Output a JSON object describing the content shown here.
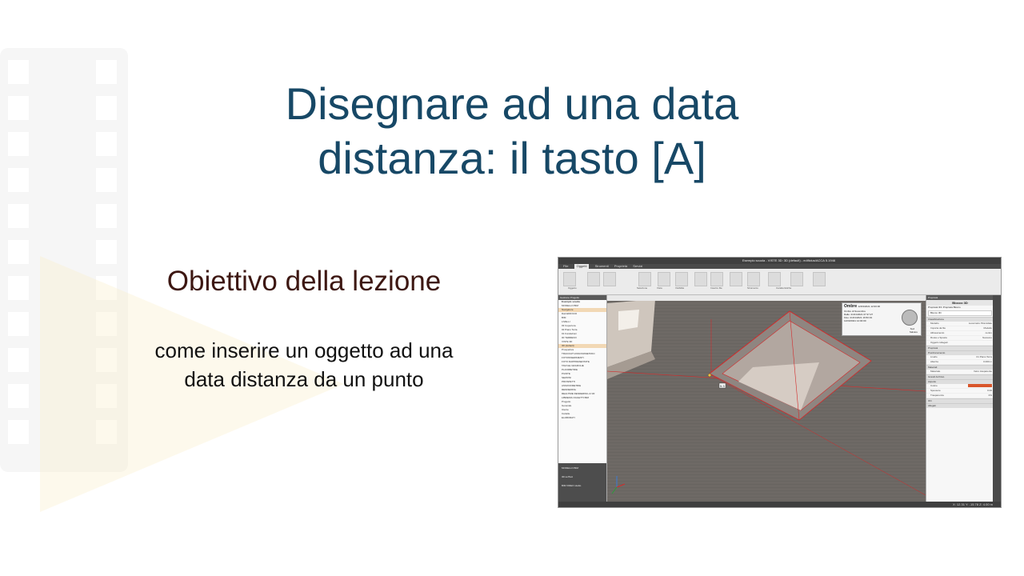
{
  "slide": {
    "title_line1": "Disegnare ad una data",
    "title_line2": "distanza: il tasto [A]",
    "subtitle": "Obiettivo della lezione",
    "body_line1": "come inserire un oggetto ad una",
    "body_line2": "data distanza da un punto"
  },
  "colors": {
    "title": "#174866",
    "subtitle": "#3d1712",
    "body": "#111111",
    "highlight_red": "#d42a2a",
    "selection_orange": "#f2d8b5"
  },
  "screenshot": {
    "window_title": "Esempio scuola - VISTE 3D: 3D (default) - edificius/ACCA 5.1946",
    "menu": [
      "File",
      "Oggetti",
      "Strumenti",
      "Proprietà",
      "Servizi"
    ],
    "active_menu": "Oggetti",
    "ribbon_groups": [
      "Oggetto",
      "Selezione",
      "Vista",
      "Visibilità",
      "Gruppi",
      "Inserire file",
      "Vista",
      "Strumento",
      "Caratteristiche"
    ],
    "left_panel": {
      "header": "Gestione Progetto",
      "project": "Esempio scuola",
      "items": [
        "MODELLO BIM",
        "Navigatore",
        "Dati EDIFICIO",
        "BIM",
        "LIVELLI",
        "03 Copertura",
        "02 Piano Terra",
        "01 Fondazioni",
        "00 TERRENO",
        "VISTE 3D",
        "3D (default)",
        "Prospettiva",
        "TRACCIATI ASSONOMETRICI",
        "FOTOINSERIMENTI",
        "FOTO RAPPRESENTATE",
        "TAVOLE GRAFICHE",
        "PLANIMETRIE",
        "PIANTE",
        "SEZIONI",
        "PROSPETTI",
        "ASSONOMETRIE",
        "RENDERING",
        "REALTIME RENDERING & VR",
        "LIBRERIA OGGETTI BIM",
        "Progetto",
        "Generale",
        "Utente",
        "Cartelle",
        "ELABORATI"
      ],
      "footer_items": [
        "MODELLO BIM",
        "3D solTool",
        "BIM VIDEO studio"
      ]
    },
    "viewport_overlay": {
      "title": "Ombre",
      "date": "12/03/2021 12:00:00",
      "row1": "Ombre di Novembre",
      "row_from": "Dalle: 21/01/2021 07:37:27",
      "row_to": "Fine: 21/01/2021 16:50:19",
      "time": "12/03/2021 12:00:00",
      "compass_label": "Sud",
      "button": "Salvare"
    },
    "viewport_label": "5.3",
    "right_panel": {
      "header": "Proprietà",
      "object_name": "Blocco 3D",
      "tabs": [
        "Proprietà IFC",
        "Proprietà Blocco"
      ],
      "filter": "Blocco 3D",
      "sections": [
        "Classificazione",
        "Proprietà",
        "Posizionamento",
        "Materiali",
        "Grandi Archivio",
        "Aspetto",
        "IFC",
        "Allegati"
      ],
      "rows": [
        {
          "k": "Modello",
          "v": "Lucernario Piramidale"
        },
        {
          "k": "Importa da file",
          "v": "Modello"
        },
        {
          "k": "Allineamento",
          "v": "centro"
        },
        {
          "k": "Ruota e Sposta",
          "v": "Nessuno"
        },
        {
          "k": "Oggetti collegati",
          "v": ""
        },
        {
          "k": "Livello",
          "v": "01 Piano Terra"
        },
        {
          "k": "Altezza",
          "v": "0.000 m"
        },
        {
          "k": "Materiale",
          "v": "Vetro trasparente"
        },
        {
          "k": "Colore",
          "v": ""
        },
        {
          "k": "Spessore",
          "v": "0.00"
        },
        {
          "k": "Trasparenza",
          "v": "0%"
        }
      ]
    },
    "status_text": "X: 12.31  Y: -15.78  Z: 4.00 m"
  }
}
